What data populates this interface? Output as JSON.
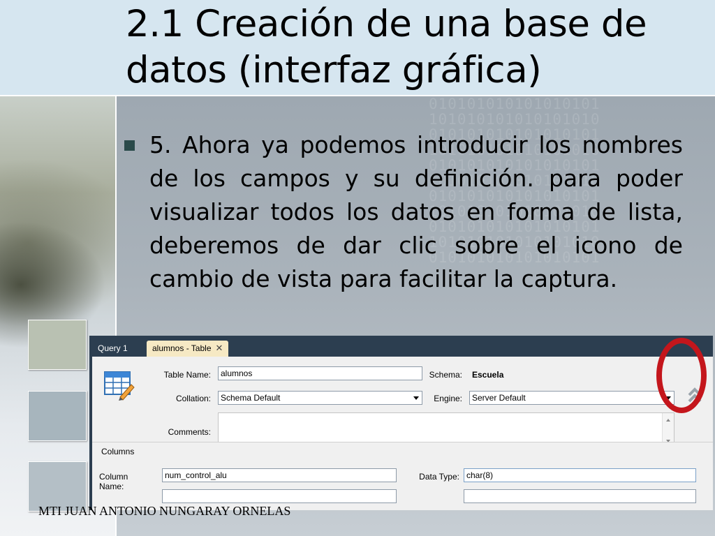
{
  "slide": {
    "title": "2.1 Creación de una base de datos (interfaz gráfica)",
    "bullet_text": "5. Ahora ya podemos introducir los nombres de los campos y su definición. para poder visualizar todos los datos en forma de lista, deberemos de dar clic sobre el icono de cambio de vista para facilitar la captura.",
    "footer": "MTI JUAN ANTONIO NUNGARAY ORNELAS",
    "binary_pattern": "0 1 0 1 0 1 0 1 0 1 0 1 0 1 0 1 0 1"
  },
  "workbench": {
    "tabs": [
      {
        "label": "Query 1",
        "active": false
      },
      {
        "label": "alumnos - Table",
        "active": true,
        "close": "✕"
      }
    ],
    "table_name": {
      "label": "Table Name:",
      "value": "alumnos"
    },
    "schema": {
      "label": "Schema:",
      "value": "Escuela"
    },
    "collation": {
      "label": "Collation:",
      "value": "Schema Default"
    },
    "engine": {
      "label": "Engine:",
      "value": "Server Default"
    },
    "comments": {
      "label": "Comments:",
      "value": ""
    },
    "columns_section": "Columns",
    "column_name": {
      "label": "Column Name:",
      "value": "num_control_alu"
    },
    "data_type": {
      "label": "Data Type:",
      "value": "char(8)"
    },
    "collapse_icon": "double-chevron-up-icon",
    "table_icon": "table-edit-icon"
  },
  "colors": {
    "title_band": "#d6e6f0",
    "content_bg": "#a9b2ba",
    "workbench_dark": "#2c3e50",
    "active_tab": "#f6e9c4",
    "highlight_ring": "#c4161c",
    "bullet": "#2a4a4a"
  }
}
